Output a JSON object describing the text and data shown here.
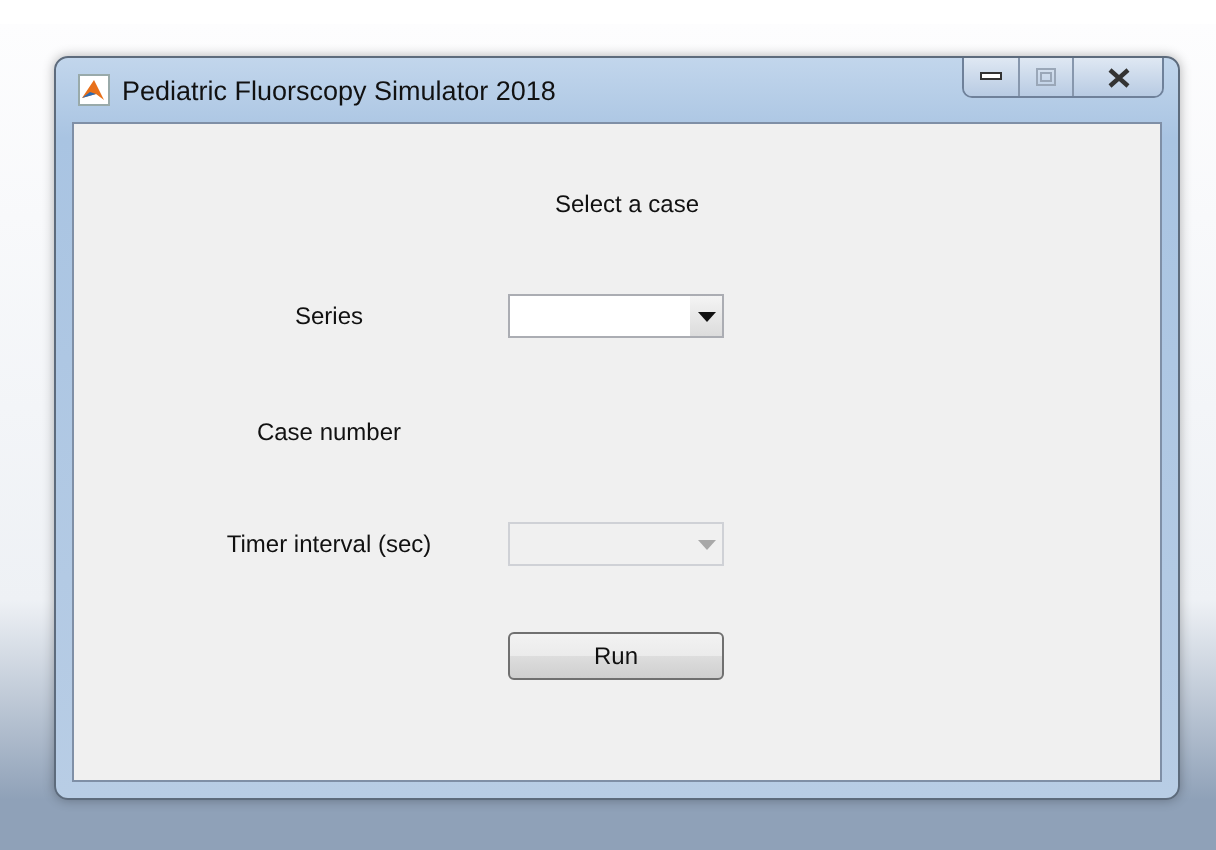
{
  "window": {
    "title": "Pediatric Fluorscopy Simulator 2018"
  },
  "heading": "Select a case",
  "fields": [
    {
      "label": "Series",
      "kind": "dropdown",
      "disabled": false
    },
    {
      "label": "Case number",
      "kind": "label"
    },
    {
      "label": "Timer interval (sec)",
      "kind": "dropdown",
      "disabled": true
    }
  ],
  "button": "Run"
}
